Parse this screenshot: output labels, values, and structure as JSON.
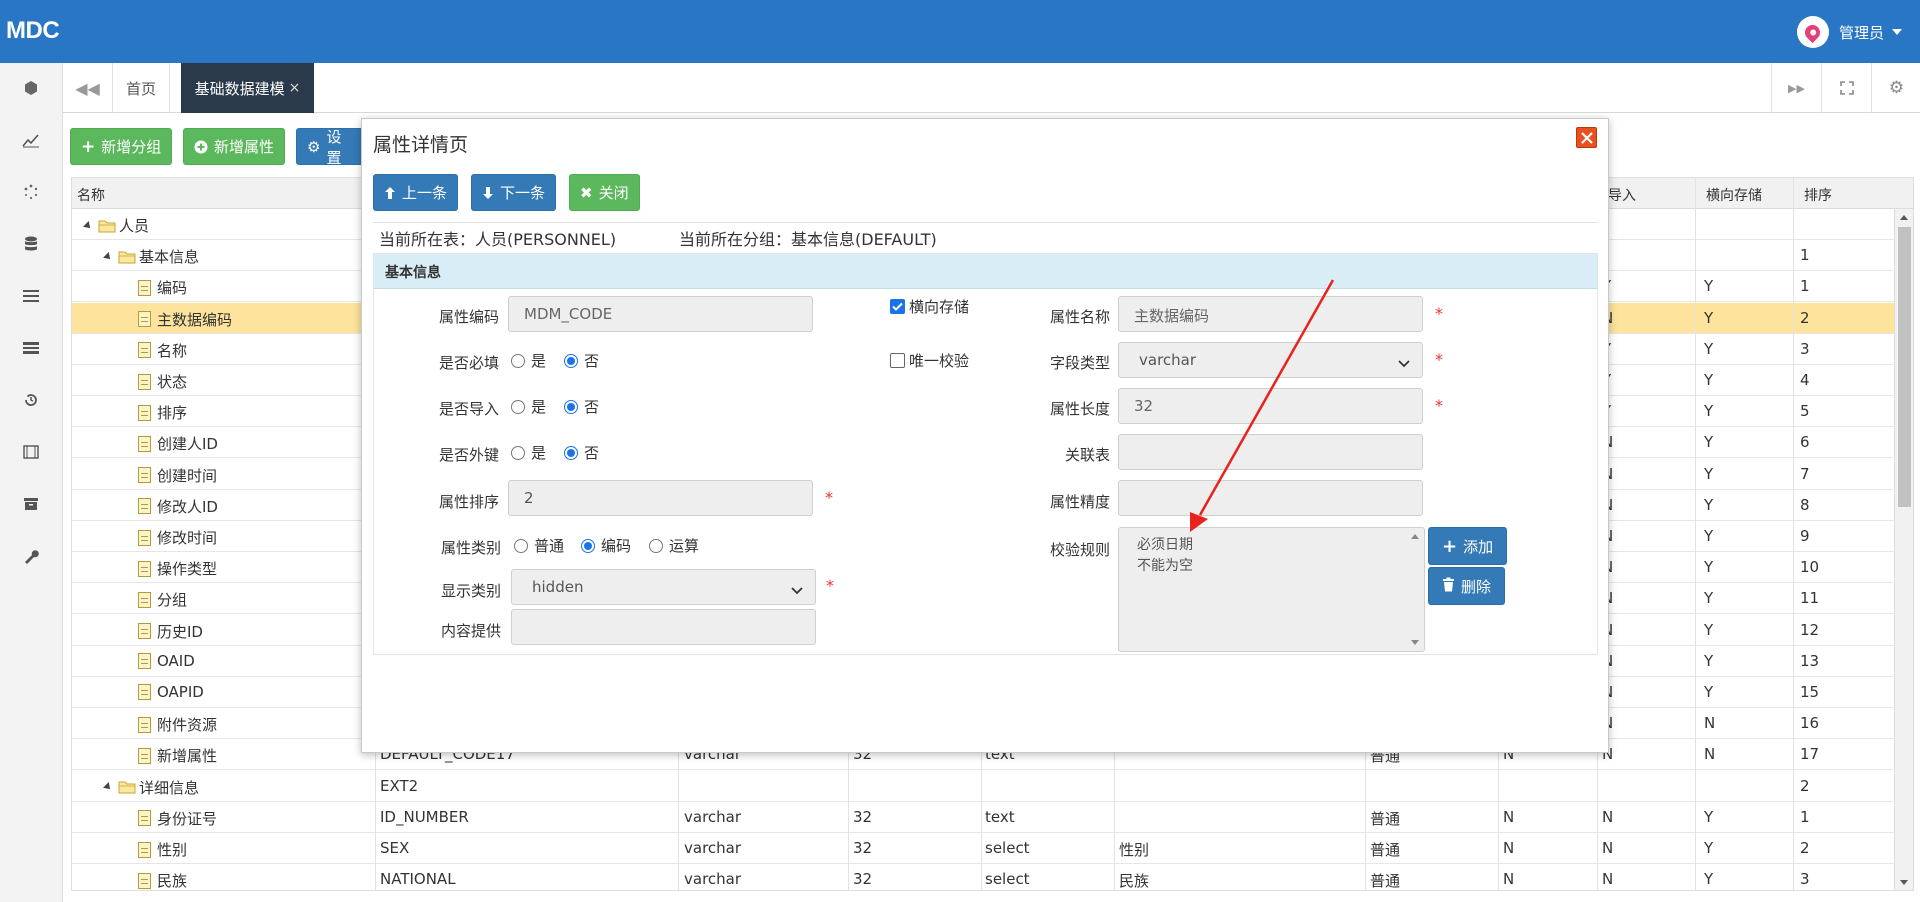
{
  "app": {
    "logo": "MDC",
    "user": "管理员"
  },
  "tabs": {
    "home": "首页",
    "active": "基础数据建模",
    "active_close": "×"
  },
  "toolbar": {
    "add_group": "新增分组",
    "add_attr": "新增属性",
    "settings": "设置"
  },
  "grid": {
    "headers": {
      "name": "名称",
      "import": "导入",
      "horizontal_storage": "横向存储",
      "sort": "排序"
    },
    "rows": [
      {
        "name": "人员",
        "type": "folder",
        "level": 0,
        "code": "",
        "field_type": "",
        "length": "",
        "display": "",
        "dict": "",
        "category": "",
        "required": "",
        "import": "",
        "horiz": "",
        "sort": ""
      },
      {
        "name": "基本信息",
        "type": "folder",
        "level": 1,
        "code": "",
        "field_type": "",
        "length": "",
        "display": "",
        "dict": "",
        "category": "",
        "required": "",
        "import": "",
        "horiz": "",
        "sort": "1"
      },
      {
        "name": "编码",
        "type": "doc",
        "level": 2,
        "code": "",
        "field_type": "",
        "length": "",
        "display": "",
        "dict": "",
        "category": "",
        "required": "",
        "import": "Y",
        "horiz": "Y",
        "sort": "1"
      },
      {
        "name": "主数据编码",
        "type": "doc",
        "level": 2,
        "selected": true,
        "code": "",
        "field_type": "",
        "length": "",
        "display": "",
        "dict": "",
        "category": "",
        "required": "",
        "import": "N",
        "horiz": "Y",
        "sort": "2"
      },
      {
        "name": "名称",
        "type": "doc",
        "level": 2,
        "code": "",
        "field_type": "",
        "length": "",
        "display": "",
        "dict": "",
        "category": "",
        "required": "",
        "import": "Y",
        "horiz": "Y",
        "sort": "3"
      },
      {
        "name": "状态",
        "type": "doc",
        "level": 2,
        "code": "",
        "field_type": "",
        "length": "",
        "display": "",
        "dict": "",
        "category": "",
        "required": "",
        "import": "Y",
        "horiz": "Y",
        "sort": "4"
      },
      {
        "name": "排序",
        "type": "doc",
        "level": 2,
        "code": "",
        "field_type": "",
        "length": "",
        "display": "",
        "dict": "",
        "category": "",
        "required": "",
        "import": "Y",
        "horiz": "Y",
        "sort": "5"
      },
      {
        "name": "创建人ID",
        "type": "doc",
        "level": 2,
        "code": "",
        "field_type": "",
        "length": "",
        "display": "",
        "dict": "",
        "category": "",
        "required": "",
        "import": "N",
        "horiz": "Y",
        "sort": "6"
      },
      {
        "name": "创建时间",
        "type": "doc",
        "level": 2,
        "code": "",
        "field_type": "",
        "length": "",
        "display": "",
        "dict": "",
        "category": "",
        "required": "",
        "import": "N",
        "horiz": "Y",
        "sort": "7"
      },
      {
        "name": "修改人ID",
        "type": "doc",
        "level": 2,
        "code": "",
        "field_type": "",
        "length": "",
        "display": "",
        "dict": "",
        "category": "",
        "required": "",
        "import": "N",
        "horiz": "Y",
        "sort": "8"
      },
      {
        "name": "修改时间",
        "type": "doc",
        "level": 2,
        "code": "",
        "field_type": "",
        "length": "",
        "display": "",
        "dict": "",
        "category": "",
        "required": "",
        "import": "N",
        "horiz": "Y",
        "sort": "9"
      },
      {
        "name": "操作类型",
        "type": "doc",
        "level": 2,
        "code": "",
        "field_type": "",
        "length": "",
        "display": "",
        "dict": "",
        "category": "",
        "required": "",
        "import": "N",
        "horiz": "Y",
        "sort": "10"
      },
      {
        "name": "分组",
        "type": "doc",
        "level": 2,
        "code": "",
        "field_type": "",
        "length": "",
        "display": "",
        "dict": "",
        "category": "",
        "required": "",
        "import": "N",
        "horiz": "Y",
        "sort": "11"
      },
      {
        "name": "历史ID",
        "type": "doc",
        "level": 2,
        "code": "",
        "field_type": "",
        "length": "",
        "display": "",
        "dict": "",
        "category": "",
        "required": "",
        "import": "N",
        "horiz": "Y",
        "sort": "12"
      },
      {
        "name": "OAID",
        "type": "doc",
        "level": 2,
        "code": "",
        "field_type": "",
        "length": "",
        "display": "",
        "dict": "",
        "category": "",
        "required": "",
        "import": "N",
        "horiz": "Y",
        "sort": "13"
      },
      {
        "name": "OAPID",
        "type": "doc",
        "level": 2,
        "code": "",
        "field_type": "",
        "length": "",
        "display": "",
        "dict": "",
        "category": "",
        "required": "",
        "import": "N",
        "horiz": "Y",
        "sort": "15"
      },
      {
        "name": "附件资源",
        "type": "doc",
        "level": 2,
        "code": "",
        "field_type": "",
        "length": "",
        "display": "",
        "dict": "",
        "category": "",
        "required": "",
        "import": "N",
        "horiz": "N",
        "sort": "16"
      },
      {
        "name": "新增属性",
        "type": "doc",
        "level": 2,
        "code": "DEFAULT_CODE17",
        "field_type": "varchar",
        "length": "32",
        "display": "text",
        "dict": "",
        "category": "普通",
        "required": "N",
        "import": "N",
        "horiz": "N",
        "sort": "17"
      },
      {
        "name": "详细信息",
        "type": "folder",
        "level": 1,
        "code": "EXT2",
        "field_type": "",
        "length": "",
        "display": "",
        "dict": "",
        "category": "",
        "required": "",
        "import": "",
        "horiz": "",
        "sort": "2"
      },
      {
        "name": "身份证号",
        "type": "doc",
        "level": 2,
        "code": "ID_NUMBER",
        "field_type": "varchar",
        "length": "32",
        "display": "text",
        "dict": "",
        "category": "普通",
        "required": "N",
        "import": "N",
        "horiz": "Y",
        "sort": "1"
      },
      {
        "name": "性别",
        "type": "doc",
        "level": 2,
        "code": "SEX",
        "field_type": "varchar",
        "length": "32",
        "display": "select",
        "dict": "性别",
        "category": "普通",
        "required": "N",
        "import": "N",
        "horiz": "Y",
        "sort": "2"
      },
      {
        "name": "民族",
        "type": "doc",
        "level": 2,
        "code": "NATIONAL",
        "field_type": "varchar",
        "length": "32",
        "display": "select",
        "dict": "民族",
        "category": "普通",
        "required": "N",
        "import": "N",
        "horiz": "Y",
        "sort": "3"
      }
    ]
  },
  "modal": {
    "title": "属性详情页",
    "prev": "上一条",
    "next": "下一条",
    "close": "关闭",
    "current_table": "当前所在表：人员(PERSONNEL)",
    "current_group": "当前所在分组：基本信息(DEFAULT)",
    "section": "基本信息",
    "attr_code_label": "属性编码",
    "attr_code_placeholder": "MDM_CODE",
    "required_label": "是否必填",
    "import_label": "是否导入",
    "fk_label": "是否外键",
    "yes": "是",
    "no": "否",
    "sort_label": "属性排序",
    "sort_value": "2",
    "category_label": "属性类别",
    "cat_normal": "普通",
    "cat_code": "编码",
    "cat_calc": "运算",
    "display_label": "显示类别",
    "display_value": "hidden",
    "content_label": "内容提供",
    "horiz_check": "横向存储",
    "unique_check": "唯一校验",
    "attr_name_label": "属性名称",
    "attr_name_placeholder": "主数据编码",
    "field_type_label": "字段类型",
    "field_type_value": "varchar",
    "length_label": "属性长度",
    "length_value": "32",
    "ref_table_label": "关联表",
    "precision_label": "属性精度",
    "rules_label": "校验规则",
    "rules": [
      "必须日期",
      "不能为空"
    ],
    "add": "添加",
    "delete": "删除"
  },
  "colors": {
    "topbar": "#2977c4",
    "green": "#5cb85c",
    "blue": "#337ab7",
    "selected_row": "#fde39b",
    "annotation_arrow": "#e8231c"
  }
}
